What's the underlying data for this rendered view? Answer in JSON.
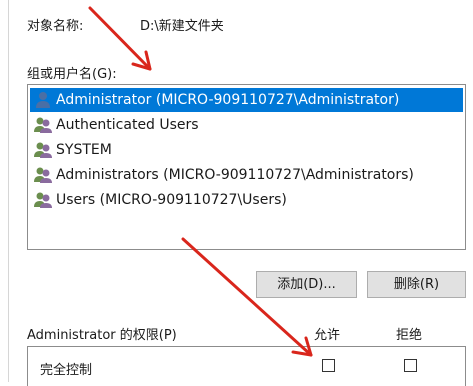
{
  "object": {
    "label": "对象名称:",
    "value": "D:\\新建文件夹"
  },
  "group_label": "组或用户名(G):",
  "users": [
    {
      "name": "Administrator (MICRO-909110727\\Administrator)",
      "icon": "single-user-icon",
      "selected": true
    },
    {
      "name": "Authenticated Users",
      "icon": "user-group-icon",
      "selected": false
    },
    {
      "name": "SYSTEM",
      "icon": "user-group-icon",
      "selected": false
    },
    {
      "name": "Administrators (MICRO-909110727\\Administrators)",
      "icon": "user-group-icon",
      "selected": false
    },
    {
      "name": "Users (MICRO-909110727\\Users)",
      "icon": "user-group-icon",
      "selected": false
    }
  ],
  "buttons": {
    "add": "添加(D)...",
    "remove": "删除(R)"
  },
  "permissions": {
    "title": "Administrator 的权限(P)",
    "allow_header": "允许",
    "deny_header": "拒绝",
    "rows": [
      {
        "label": "完全控制",
        "allow": false,
        "deny": false
      }
    ]
  },
  "colors": {
    "selection": "#0078d7",
    "annotation_arrow": "#d9261c"
  }
}
